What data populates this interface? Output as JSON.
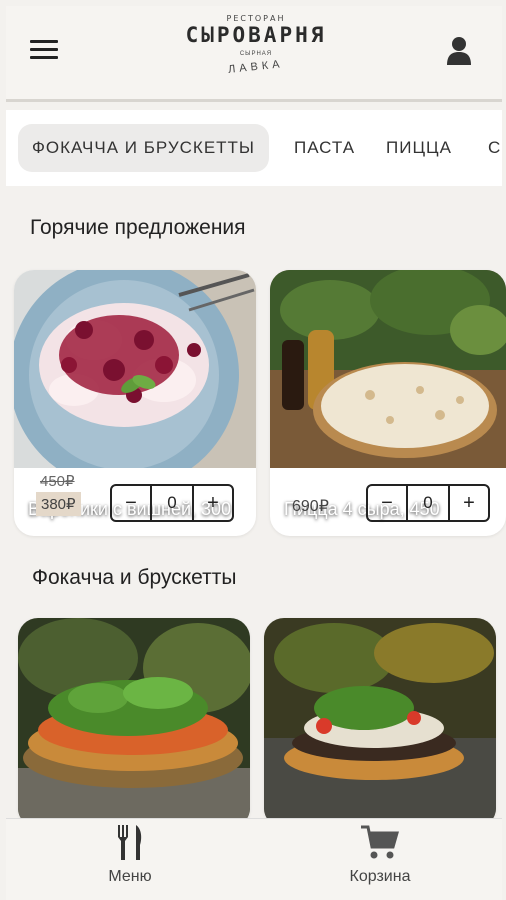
{
  "header": {
    "logo_top": "РЕСТОРАН",
    "logo_main": "СЫРОВАРНЯ",
    "logo_sub1": "СЫРНАЯ",
    "logo_sub2": "ЛАВКА"
  },
  "tabs": [
    {
      "label": "ФОКАЧЧА И БРУСКЕТТЫ",
      "active": true
    },
    {
      "label": "ПАСТА"
    },
    {
      "label": "ПИЦЦА"
    },
    {
      "label": "С"
    }
  ],
  "sections": {
    "hot": "Горячие предложения",
    "focaccia": "Фокачча и брускетты"
  },
  "hot_items": [
    {
      "title": "Вареники с вишней, 300",
      "old_price": "450₽",
      "new_price": "380₽",
      "qty": "0"
    },
    {
      "title": "Пицца 4 сыра, 450",
      "price": "690₽",
      "qty": "0"
    }
  ],
  "stepper": {
    "minus": "−",
    "plus": "+"
  },
  "bottom_nav": {
    "menu": "Меню",
    "cart": "Корзина"
  },
  "colors": {
    "price_highlight": "#e4d8c9",
    "background": "#f3f1ee"
  }
}
